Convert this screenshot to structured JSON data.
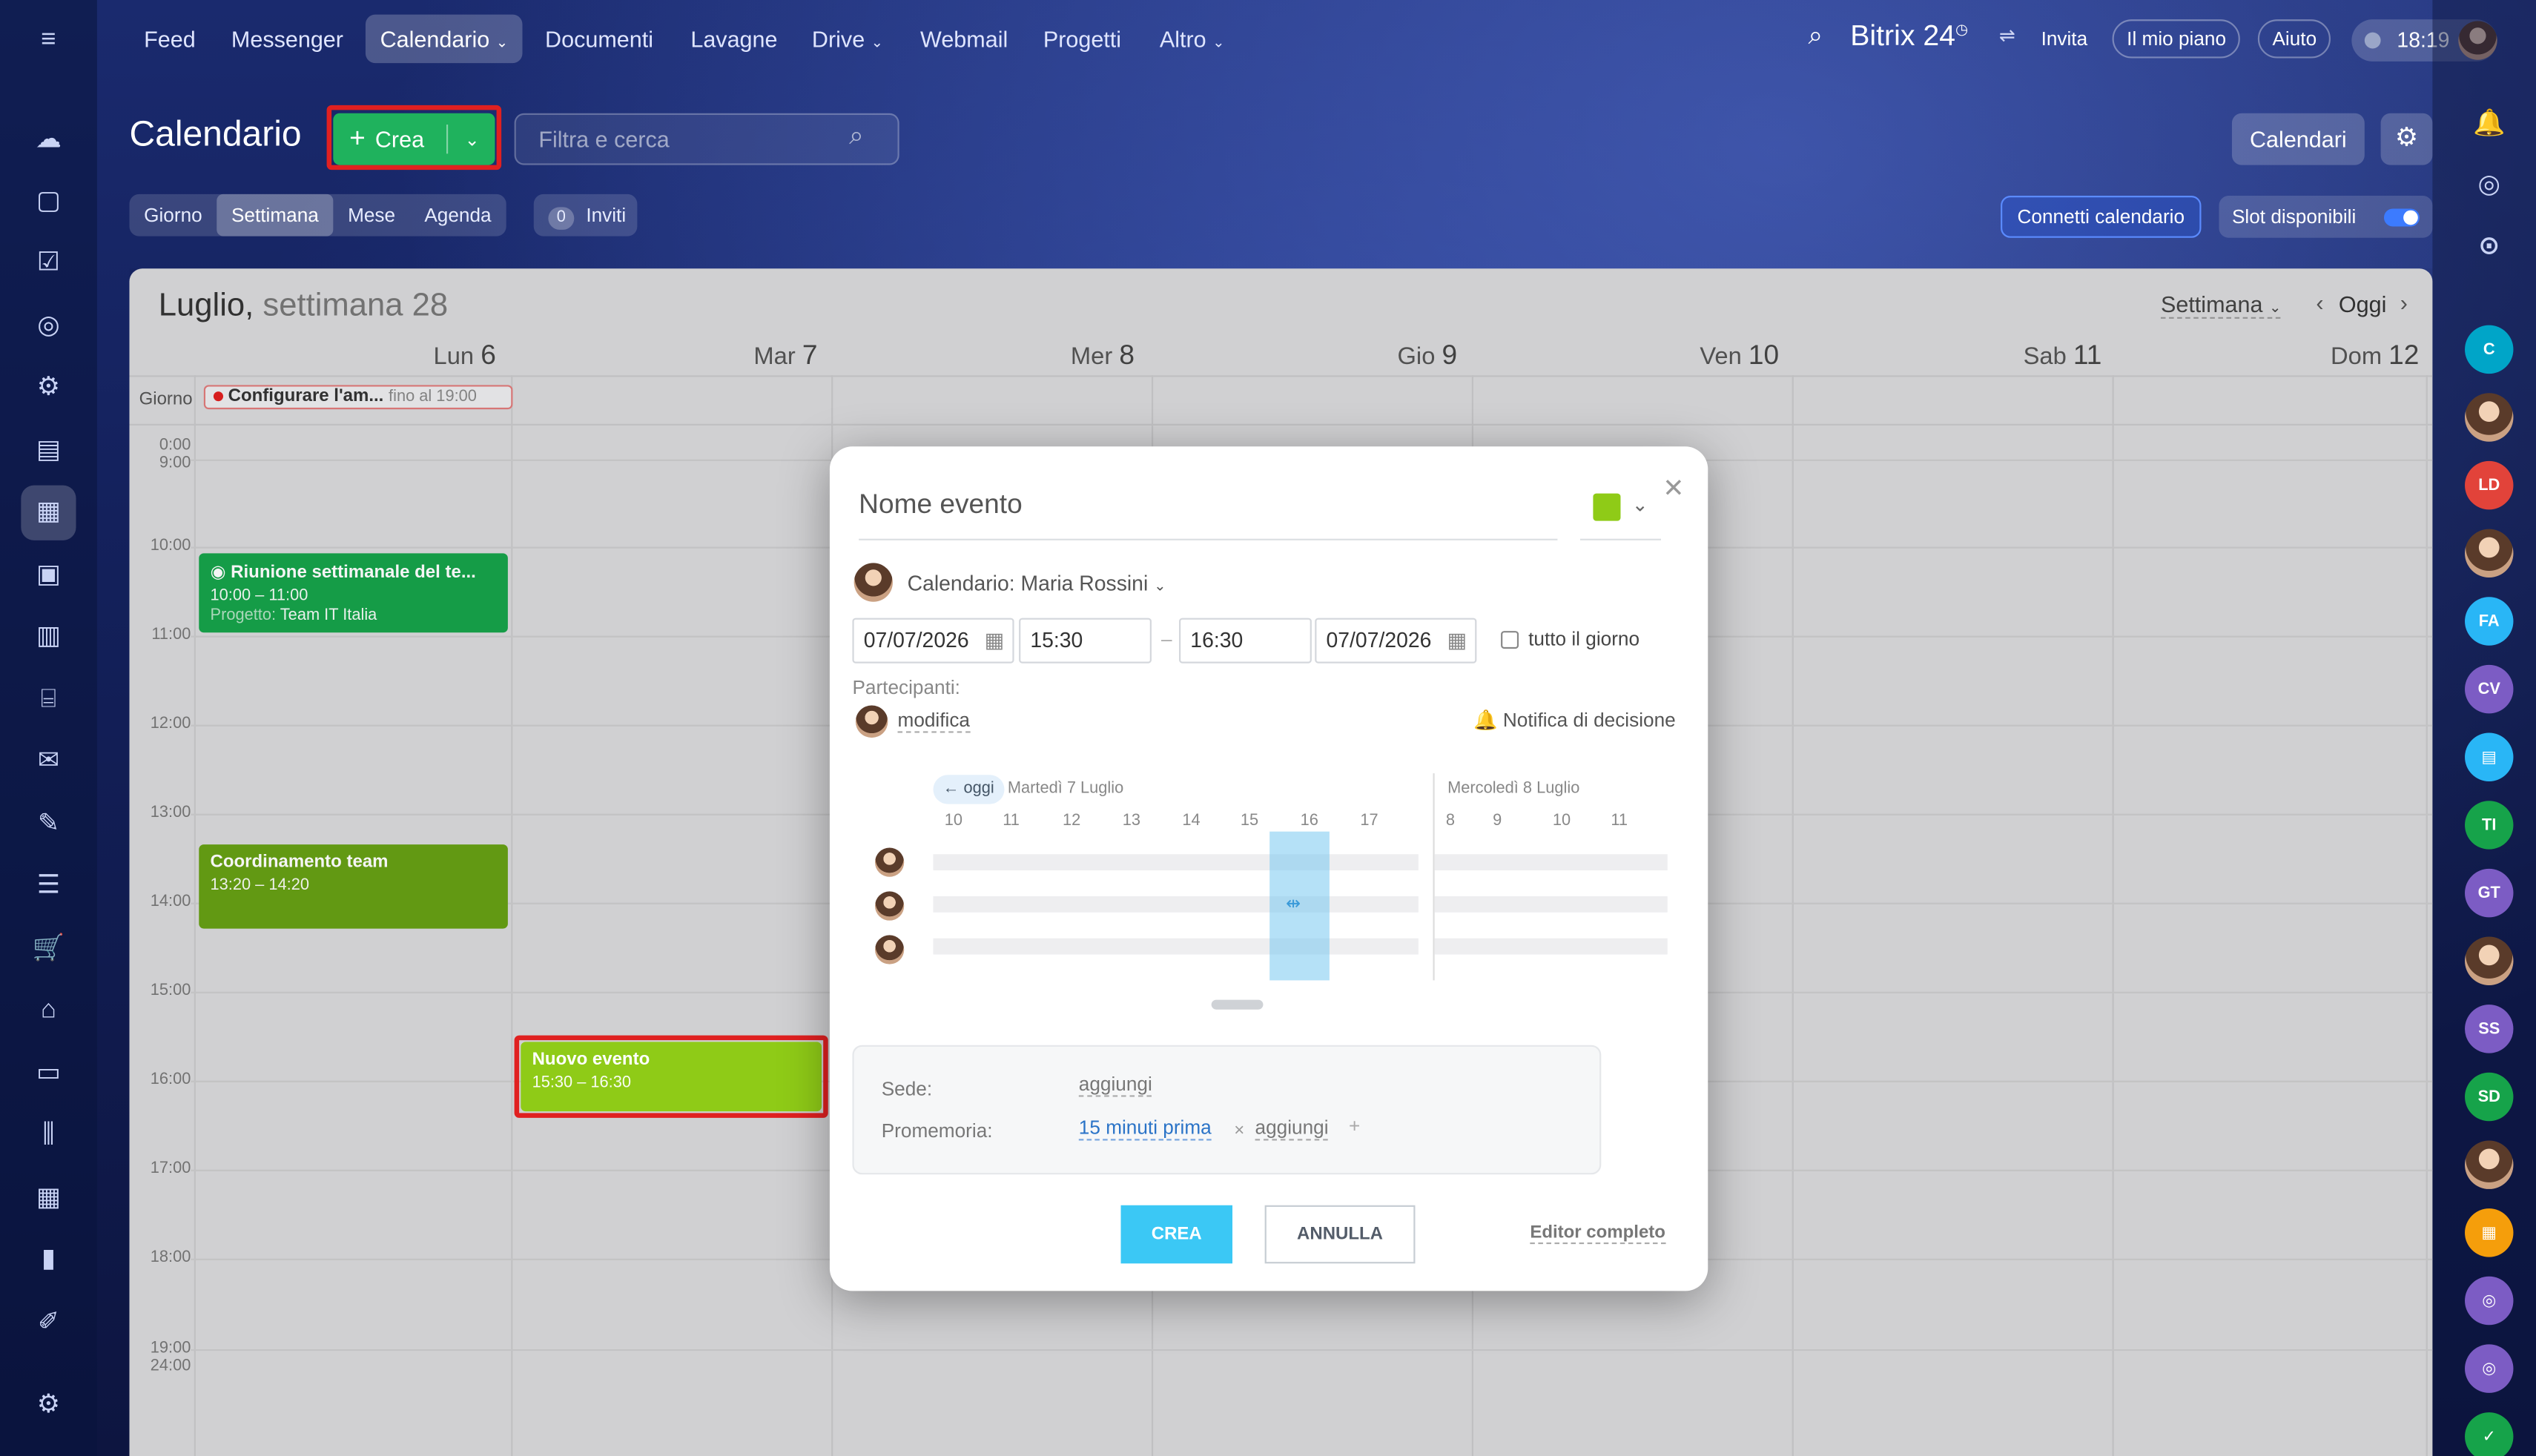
{
  "topnav": {
    "items": [
      "Feed",
      "Messenger",
      "Calendario",
      "Documenti",
      "Lavagne",
      "Drive",
      "Webmail",
      "Progetti",
      "Altro"
    ],
    "active": "Calendario",
    "brand": "Bitrix 24",
    "invite": "Invita",
    "plan": "Il mio piano",
    "help": "Aiuto",
    "time": "18:19"
  },
  "header": {
    "title": "Calendario",
    "create_label": "Crea",
    "search_placeholder": "Filtra e cerca",
    "calendars_button": "Calendari"
  },
  "view_tabs": [
    "Giorno",
    "Settimana",
    "Mese",
    "Agenda"
  ],
  "view_tabs_active": "Settimana",
  "invites": {
    "count": "0",
    "label": "Inviti"
  },
  "connect_calendar": "Connetti calendario",
  "slots": "Slot disponibili",
  "calendar": {
    "month_title": "Luglio,",
    "week_title": "settimana 28",
    "view_select": "Settimana",
    "today": "Oggi",
    "all_day_label": "Giorno",
    "days": [
      {
        "name": "Lun",
        "num": "6"
      },
      {
        "name": "Mar",
        "num": "7"
      },
      {
        "name": "Mer",
        "num": "8"
      },
      {
        "name": "Gio",
        "num": "9"
      },
      {
        "name": "Ven",
        "num": "10"
      },
      {
        "name": "Sab",
        "num": "11"
      },
      {
        "name": "Dom",
        "num": "12"
      }
    ],
    "all_day_event": {
      "title": "Configurare l'am...",
      "until": "fino al 19:00"
    },
    "hours": [
      "10:00",
      "11:00",
      "12:00",
      "13:00",
      "14:00",
      "15:00",
      "16:00",
      "17:00",
      "18:00"
    ],
    "hours_top": [
      "0:00",
      "9:00"
    ],
    "hours_bottom": [
      "19:00",
      "24:00"
    ],
    "events": [
      {
        "title": "Riunione settimanale del te...",
        "time": "10:00 – 11:00",
        "project_label": "Progetto:",
        "project": "Team IT Italia"
      },
      {
        "title": "Coordinamento team",
        "time": "13:20 – 14:20"
      },
      {
        "title": "Nuovo evento",
        "time": "15:30 – 16:30"
      }
    ]
  },
  "modal": {
    "name_placeholder": "Nome evento",
    "color": "#8fcb17",
    "calendar_label": "Calendario: Maria Rossini",
    "date_from": "07/07/2026",
    "time_from": "15:30",
    "time_to": "16:30",
    "date_to": "07/07/2026",
    "all_day": "tutto il giorno",
    "participants_label": "Partecipanti:",
    "modify": "modifica",
    "notify": "Notifica di decisione",
    "today_btn": "← oggi",
    "day1": "Martedì 7 Luglio",
    "day2": "Mercoledì 8 Luglio",
    "hours1": [
      "10",
      "11",
      "12",
      "13",
      "14",
      "15",
      "16",
      "17"
    ],
    "hours2": [
      "8",
      "9",
      "10",
      "11"
    ],
    "location_label": "Sede:",
    "location_value": "aggiungi",
    "reminder_label": "Promemoria:",
    "reminder_value": "15 minuti prima",
    "reminder_add": "aggiungi",
    "create": "CREA",
    "cancel": "ANNULLA",
    "full_editor": "Editor completo"
  },
  "right_bar": [
    {
      "label": "C",
      "color": "#00a5c8"
    },
    {
      "label": "LD",
      "color": "#e2433a"
    },
    {
      "label": "FA",
      "color": "#29b6f6"
    },
    {
      "label": "CV",
      "color": "#7c5cc4"
    },
    {
      "label": "TI",
      "color": "#16a34a"
    },
    {
      "label": "GT",
      "color": "#7c5cc4"
    },
    {
      "label": "SS",
      "color": "#7c5cc4"
    },
    {
      "label": "SD",
      "color": "#16a34a"
    }
  ]
}
